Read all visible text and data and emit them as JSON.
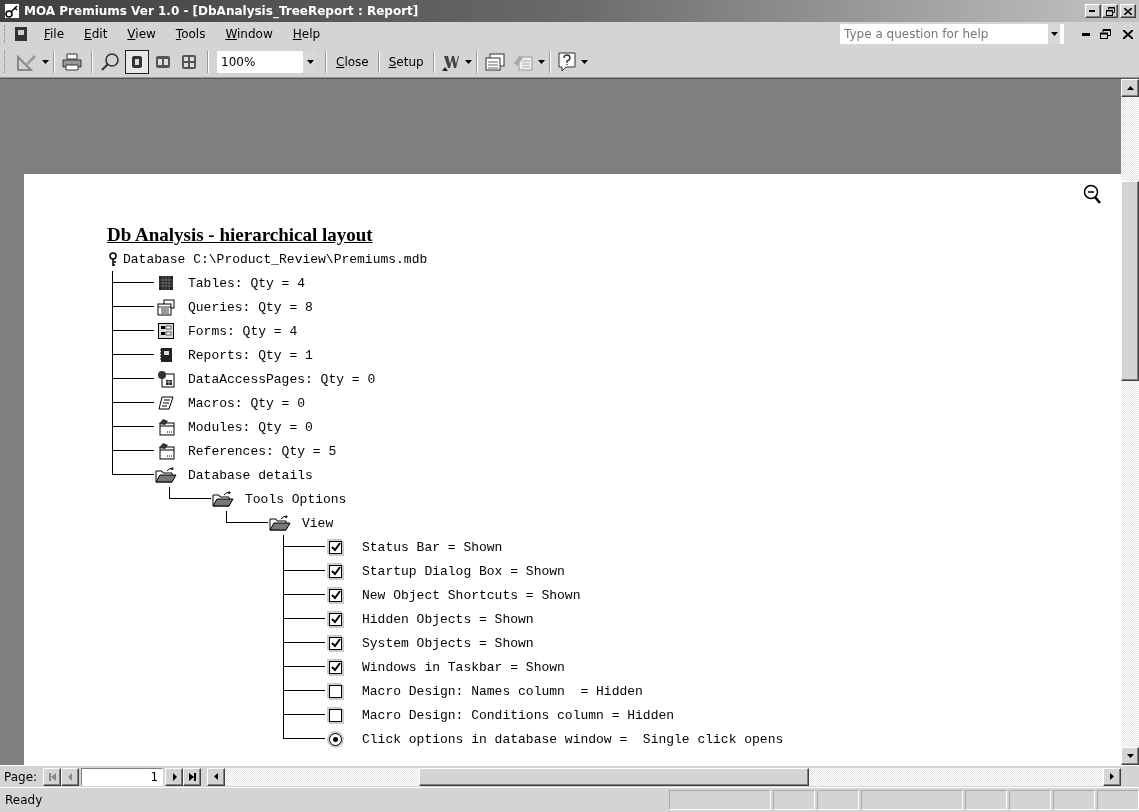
{
  "window": {
    "title": "MOA Premiums Ver 1.0 - [DbAnalysis_TreeReport : Report]"
  },
  "menu": [
    "File",
    "Edit",
    "View",
    "Tools",
    "Window",
    "Help"
  ],
  "help_box": {
    "placeholder": "Type a question for help"
  },
  "toolbar": {
    "page_views": [
      {
        "kind": "one",
        "selected": true
      },
      {
        "kind": "two",
        "selected": false
      },
      {
        "kind": "multiple",
        "selected": false
      }
    ],
    "zoom": "100%",
    "buttons": [
      "Close",
      "Setup"
    ]
  },
  "report": {
    "title": "Db Analysis - hierarchical layout",
    "tree": {
      "kind": "key",
      "text": "Database C:\\Product_Review\\Premiums.mdb",
      "children": [
        {
          "kind": "table",
          "text": "Tables: Qty = 4"
        },
        {
          "kind": "query",
          "text": "Queries: Qty = 8"
        },
        {
          "kind": "form",
          "text": "Forms: Qty = 4"
        },
        {
          "kind": "report",
          "text": "Reports: Qty = 1"
        },
        {
          "kind": "page",
          "text": "DataAccessPages: Qty = 0"
        },
        {
          "kind": "macro",
          "text": "Macros: Qty = 0"
        },
        {
          "kind": "module",
          "text": "Modules: Qty = 0"
        },
        {
          "kind": "module",
          "text": "References: Qty = 5"
        },
        {
          "kind": "folder",
          "text": "Database details",
          "children": [
            {
              "kind": "folder",
              "text": "Tools Options",
              "children": [
                {
                  "kind": "folder",
                  "text": "View",
                  "children": [
                    {
                      "kind": "checkbox",
                      "checked": true,
                      "text": "Status Bar = Shown"
                    },
                    {
                      "kind": "checkbox",
                      "checked": true,
                      "text": "Startup Dialog Box = Shown"
                    },
                    {
                      "kind": "checkbox",
                      "checked": true,
                      "text": "New Object Shortcuts = Shown"
                    },
                    {
                      "kind": "checkbox",
                      "checked": true,
                      "text": "Hidden Objects = Shown"
                    },
                    {
                      "kind": "checkbox",
                      "checked": true,
                      "text": "System Objects = Shown"
                    },
                    {
                      "kind": "checkbox",
                      "checked": true,
                      "text": "Windows in Taskbar = Shown"
                    },
                    {
                      "kind": "checkbox",
                      "checked": false,
                      "text": "Macro Design: Names column  = Hidden"
                    },
                    {
                      "kind": "checkbox",
                      "checked": false,
                      "text": "Macro Design: Conditions column = Hidden"
                    },
                    {
                      "kind": "radio",
                      "checked": true,
                      "text": "Click options in database window =  Single click opens"
                    }
                  ]
                }
              ]
            }
          ]
        }
      ]
    }
  },
  "navigation": {
    "label": "Page:",
    "page": "1"
  },
  "status_bar": {
    "text": "Ready"
  }
}
